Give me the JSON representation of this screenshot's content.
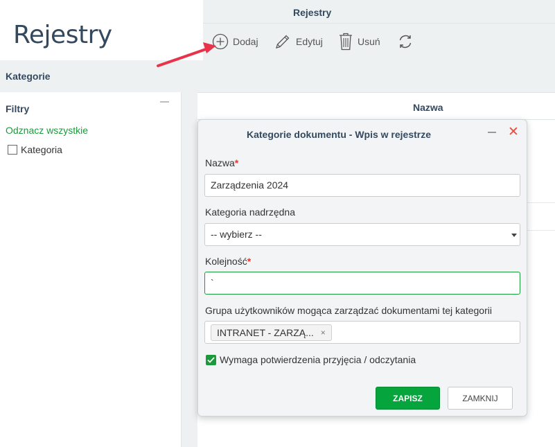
{
  "page": {
    "title": "Rejestry"
  },
  "panel": {
    "title": "Rejestry",
    "toolbar": {
      "add": "Dodaj",
      "edit": "Edytuj",
      "delete": "Usuń"
    }
  },
  "band": {
    "label": "Kategorie"
  },
  "sidebar": {
    "filters_title": "Filtry",
    "select_all": "Odznacz wszystkie",
    "category_label": "Kategoria"
  },
  "grid": {
    "column_name": "Nazwa"
  },
  "modal": {
    "title": "Kategorie dokumentu - Wpis w rejestrze",
    "required_mark": "*",
    "name": {
      "label": "Nazwa",
      "value": "Zarządzenia 2024"
    },
    "parent": {
      "label": "Kategoria nadrzędna",
      "value": "-- wybierz --"
    },
    "order": {
      "label": "Kolejność",
      "value": "`"
    },
    "group": {
      "label": "Grupa użytkowników mogąca zarządzać dokumentami tej kategorii",
      "tag": "INTRANET - ZARZĄ...",
      "tag_remove": "×"
    },
    "confirm": {
      "label": "Wymaga potwierdzenia przyjęcia / odczytania",
      "checked": true
    },
    "save": "ZAPISZ",
    "close": "ZAMKNIJ"
  },
  "colors": {
    "accent": "#06a43d",
    "link": "#1a9a3a",
    "required": "#e53935",
    "close": "#e74c3c",
    "arrow": "#e8334a"
  }
}
